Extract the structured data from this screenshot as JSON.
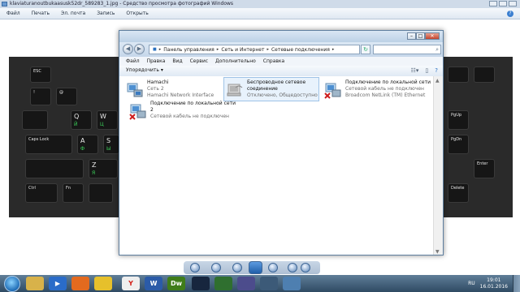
{
  "viewer": {
    "title": "klaviaturanoutbukaasusk52dr_589283_1.jpg - Средство просмотра фотографий Windows",
    "menu": [
      "Файл",
      "Печать",
      "Эл. почта",
      "Запись",
      "Открыть"
    ]
  },
  "keyboard": {
    "keys": [
      {
        "label": "ESC",
        "ru": ""
      },
      {
        "label": "!",
        "ru": ""
      },
      {
        "label": "@",
        "ru": ""
      },
      {
        "label": "Q",
        "ru": "Й"
      },
      {
        "label": "W",
        "ru": "Ц"
      },
      {
        "label": "A",
        "ru": "Ф"
      },
      {
        "label": "S",
        "ru": "Ы"
      },
      {
        "label": "Caps Lock",
        "ru": ""
      },
      {
        "label": "Z",
        "ru": "Я"
      },
      {
        "label": "Ctrl",
        "ru": ""
      },
      {
        "label": "Fn",
        "ru": ""
      },
      {
        "label": "PgUp",
        "ru": ""
      },
      {
        "label": "PgDn",
        "ru": ""
      },
      {
        "label": "Delete",
        "ru": ""
      },
      {
        "label": "Enter",
        "ru": ""
      }
    ]
  },
  "explorer": {
    "address": [
      "Панель управления",
      "Сеть и Интернет",
      "Сетевые подключения"
    ],
    "menu": [
      "Файл",
      "Правка",
      "Вид",
      "Сервис",
      "Дополнительно",
      "Справка"
    ],
    "toolbar": {
      "organize": "Упорядочить"
    },
    "connections": [
      {
        "name": "Hamachi",
        "line2": "Сеть 2",
        "line3": "Hamachi Network Interface",
        "status": "ok"
      },
      {
        "name": "Беспроводное сетевое",
        "line2": "соединение",
        "line3": "Отключено, Общедоступно",
        "status": "disabled"
      },
      {
        "name": "Подключение по локальной сети",
        "line2": "Сетевой кабель не подключен",
        "line3": "Broadcom NetLink (TM) Ethernet",
        "status": "error"
      },
      {
        "name": "Подключение по локальной сети",
        "line2": "2",
        "line3": "Сетевой кабель не подключен",
        "status": "error"
      }
    ]
  },
  "taskbar": {
    "apps": [
      "Windows Explorer",
      "Windows Media Player",
      "Firefox",
      "Sandbox",
      "Yandex Browser",
      "Word",
      "Dreamweaver",
      "Photoshop",
      "NVIDIA",
      "Media",
      "Network",
      "Photo Viewer"
    ],
    "lang": "RU",
    "time": "19:01",
    "date": "16.01.2016"
  },
  "colors": {
    "selection": "#e8f2fc",
    "taskbar": "#2f4a63",
    "error_x": "#cc1b1b"
  }
}
